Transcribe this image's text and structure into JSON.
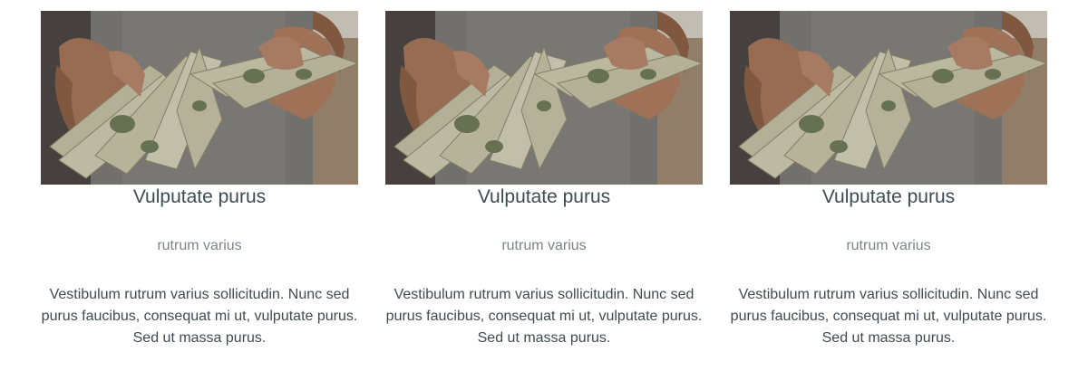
{
  "cards": [
    {
      "image": "hands-holding-dollar-bills-photo",
      "title": "Vulputate purus",
      "subtitle": "rutrum varius",
      "body": "Vestibulum rutrum varius sollicitudin. Nunc sed purus faucibus, consequat mi ut, vulputate purus. Sed ut massa purus."
    },
    {
      "image": "hands-holding-dollar-bills-photo",
      "title": "Vulputate purus",
      "subtitle": "rutrum varius",
      "body": "Vestibulum rutrum varius sollicitudin. Nunc sed purus faucibus, consequat mi ut, vulputate purus. Sed ut massa purus."
    },
    {
      "image": "hands-holding-dollar-bills-photo",
      "title": "Vulputate purus",
      "subtitle": "rutrum varius",
      "body": "Vestibulum rutrum varius sollicitudin. Nunc sed purus faucibus, consequat mi ut, vulputate purus. Sed ut massa purus."
    }
  ],
  "colors": {
    "title": "#3f4b52",
    "subtitle": "#7b858b",
    "body": "#3f4b52",
    "background": "#ffffff"
  }
}
